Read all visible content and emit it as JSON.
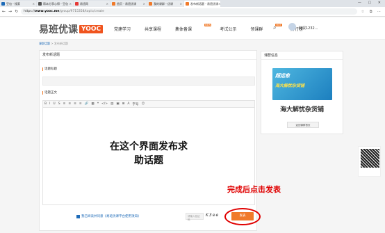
{
  "browser": {
    "tabs": [
      {
        "label": "豆包 - 搜索",
        "color": "#1e6bb8",
        "active": false
      },
      {
        "label": "帮本分享心得 - 豆包",
        "color": "#555555",
        "active": false
      },
      {
        "label": "易班网",
        "color": "#e53935",
        "active": false
      },
      {
        "label": "首页 - 易班优课",
        "color": "#f07a2a",
        "active": false
      },
      {
        "label": "我的课群 - 优课",
        "color": "#f07a2a",
        "active": false
      },
      {
        "label": "发布新话题 - 易班优课",
        "color": "#f07a2a",
        "active": true
      }
    ],
    "url_prefix": "https://",
    "url_host": "www.yooc.me",
    "url_path": "/group/9715358/topic/create"
  },
  "header": {
    "logo_text": "易班优课",
    "logo_badge": "YOOC",
    "menu": [
      {
        "label": "党建学习",
        "badge": ""
      },
      {
        "label": "共享课程",
        "badge": ""
      },
      {
        "label": "集体备课",
        "badge": "NEW"
      },
      {
        "label": "考试公示",
        "badge": ""
      },
      {
        "label": "领课群",
        "badge": "HOT"
      },
      {
        "label": "排行榜",
        "badge": ""
      }
    ],
    "username": "财贸1232..."
  },
  "breadcrumb": {
    "home": "课群话题",
    "sep": " > ",
    "current": "发布新话题"
  },
  "form": {
    "panel_title": "发布新话题",
    "title_label": "话题标题",
    "body_label": "话题正文",
    "toolbar": [
      "B",
      "I",
      "U",
      "S",
      "≡",
      "≡",
      "≡",
      "≡",
      "🔗",
      "▦",
      "❝",
      "</>",
      "▤",
      "▣",
      "⊞",
      "A",
      "字号",
      "☺"
    ],
    "editor_text_line1": "在这个界面发布求",
    "editor_text_line2": "助话题",
    "agree_text": "我已阅读并同意《易班优课平台使用须知》",
    "captcha_placeholder": "请输入验证码",
    "captcha_image_text": "K3ee",
    "publish_label": "发表"
  },
  "sidebar": {
    "title": "课群信息",
    "banner_line1": "超运愈",
    "banner_line2": "海大解忧杂货铺",
    "group_name": "海大解忧杂货铺",
    "enter_label": "返回课群首页"
  },
  "annotation": "完成后点击发表",
  "colors": {
    "accent": "#f07a2a",
    "annotation": "#e00000",
    "link": "#1e6bb8"
  }
}
